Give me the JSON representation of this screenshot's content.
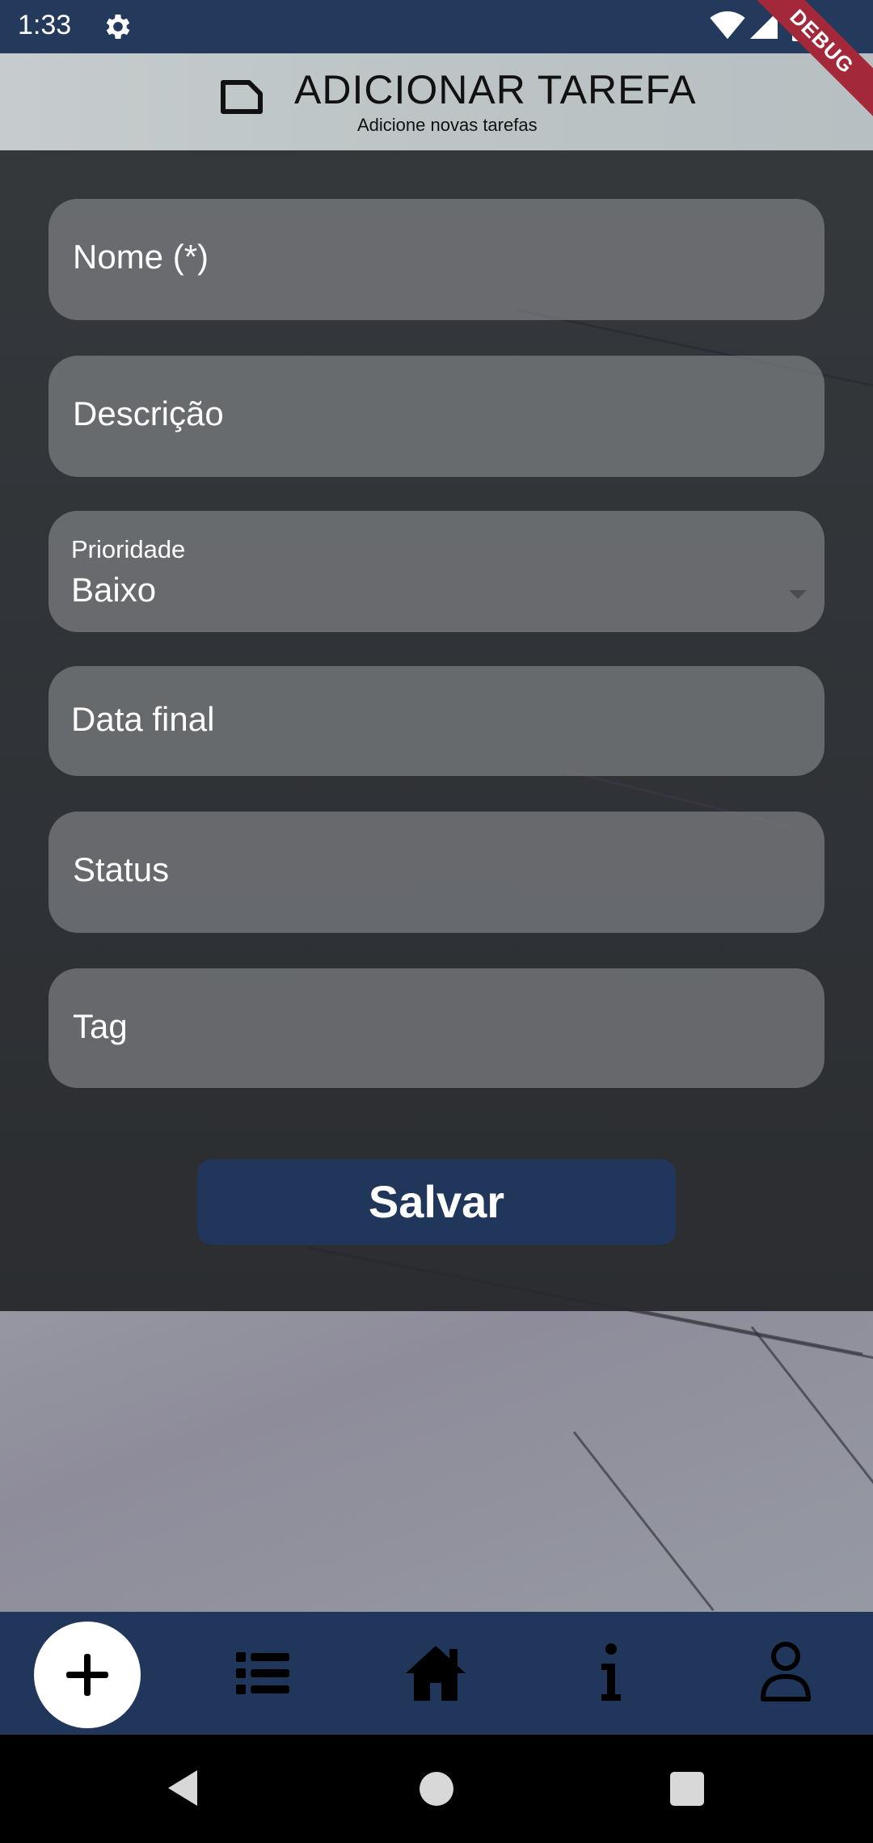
{
  "status_bar": {
    "time": "1:33",
    "debug_label": "DEBUG"
  },
  "app_bar": {
    "title": "ADICIONAR TAREFA",
    "subtitle": "Adicione novas tarefas",
    "icon": "note-icon"
  },
  "form": {
    "name_label": "Nome (*)",
    "description_label": "Descrição",
    "priority": {
      "label": "Prioridade",
      "selected": "Baixo"
    },
    "due_date_label": "Data final",
    "status_label": "Status",
    "tag_label": "Tag",
    "save_label": "Salvar"
  },
  "bottom_nav": {
    "items": [
      "add-icon",
      "list-icon",
      "home-icon",
      "info-icon",
      "person-icon"
    ]
  },
  "colors": {
    "primary": "#20365a",
    "status_bar": "#243a5c",
    "debug_ribbon": "#a3283a"
  }
}
